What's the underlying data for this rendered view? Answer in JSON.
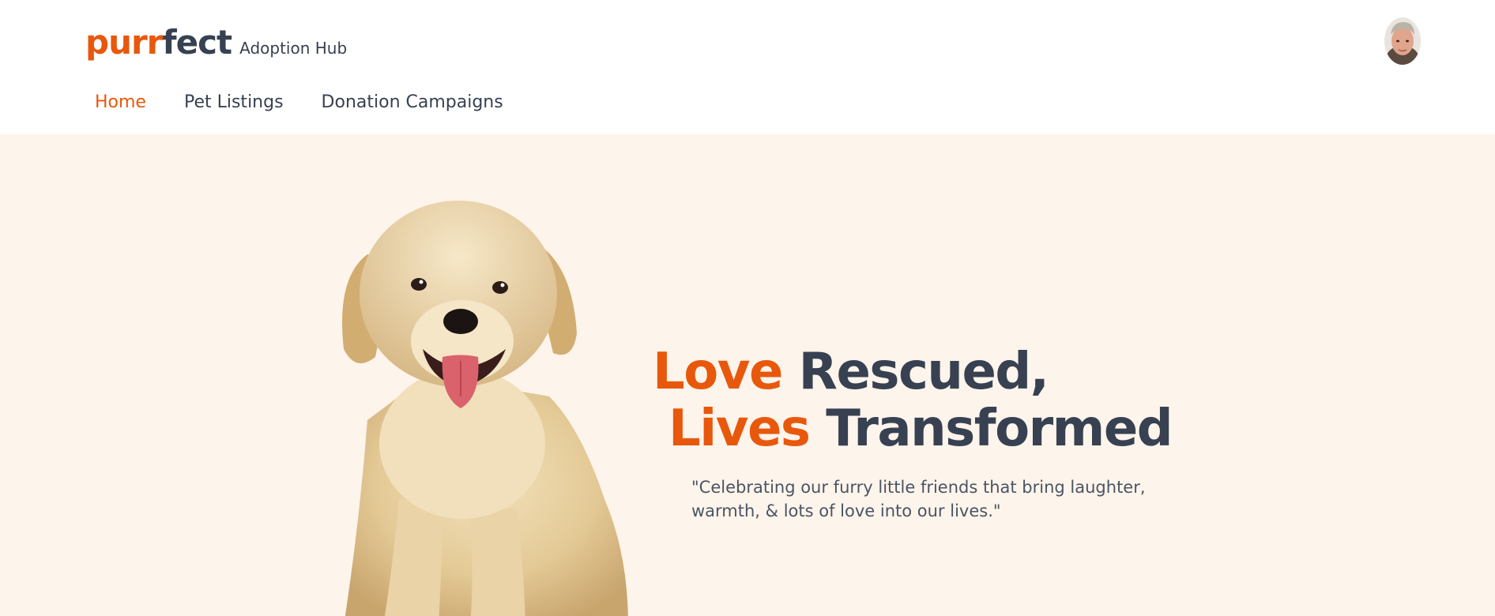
{
  "brand": {
    "logo_part1": "purr",
    "logo_part2": "fect",
    "subtitle": "Adoption Hub"
  },
  "nav": {
    "items": [
      {
        "label": "Home",
        "active": true
      },
      {
        "label": "Pet Listings",
        "active": false
      },
      {
        "label": "Donation Campaigns",
        "active": false
      }
    ]
  },
  "hero": {
    "headline": {
      "line1_accent": "Love",
      "line1_dark": "Rescued,",
      "line2_accent": "Lives",
      "line2_dark": "Transformed"
    },
    "quote": "\"Celebrating our furry little friends that bring laughter, warmth, & lots of love into our lives.\""
  },
  "colors": {
    "accent": "#e8580c",
    "dark": "#374151",
    "hero_bg": "#fdf4eb"
  },
  "icons": {
    "avatar": "user-avatar",
    "hero_image": "golden-retriever-puppy"
  }
}
